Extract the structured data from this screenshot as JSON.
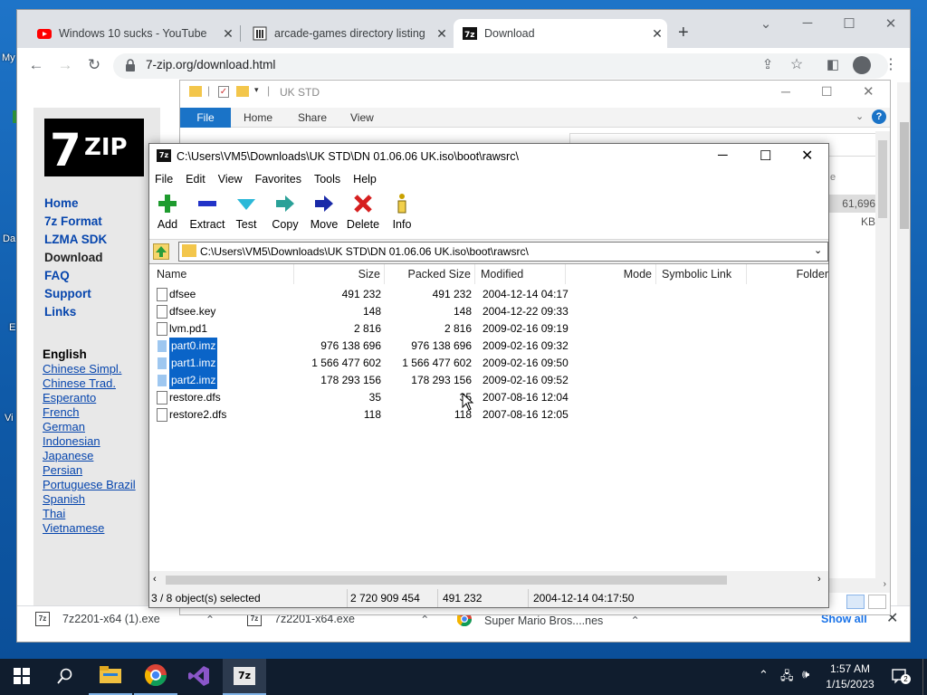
{
  "desktop": {
    "labels": [
      "My",
      "Da",
      "E",
      "Vi"
    ]
  },
  "browser": {
    "tabs": [
      {
        "title": "Windows 10 sucks - YouTube",
        "favicon": "youtube-icon"
      },
      {
        "title": "arcade-games directory listing",
        "favicon": "archive-icon"
      },
      {
        "title": "Download",
        "favicon": "7zip-icon",
        "active": true
      }
    ],
    "url": "7-zip.org/download.html"
  },
  "site": {
    "logo": "7ZIP",
    "nav": [
      "Home",
      "7z Format",
      "LZMA SDK",
      "Download",
      "FAQ",
      "Support",
      "Links"
    ],
    "current": "Download",
    "lang_heading": "English",
    "languages": [
      "Chinese Simpl.",
      "Chinese Trad.",
      "Esperanto",
      "French",
      "German",
      "Indonesian",
      "Japanese",
      "Persian",
      "Portuguese Brazil",
      "Spanish",
      "Thai",
      "Vietnamese"
    ]
  },
  "explorer": {
    "title": "UK STD",
    "ribbon": [
      "File",
      "Home",
      "Share",
      "View"
    ],
    "size_cell": "61,696 KB",
    "col_hint": "e"
  },
  "sevenzip": {
    "title": "C:\\Users\\VM5\\Downloads\\UK STD\\DN 01.06.06 UK.iso\\boot\\rawsrc\\",
    "menu": [
      "File",
      "Edit",
      "View",
      "Favorites",
      "Tools",
      "Help"
    ],
    "toolbar": [
      "Add",
      "Extract",
      "Test",
      "Copy",
      "Move",
      "Delete",
      "Info"
    ],
    "address": "C:\\Users\\VM5\\Downloads\\UK STD\\DN 01.06.06 UK.iso\\boot\\rawsrc\\",
    "columns": [
      "Name",
      "Size",
      "Packed Size",
      "Modified",
      "Mode",
      "Symbolic Link",
      "Folder"
    ],
    "files": [
      {
        "name": "dfsee",
        "size": "491 232",
        "packed": "491 232",
        "modified": "2004-12-14 04:17",
        "selected": false
      },
      {
        "name": "dfsee.key",
        "size": "148",
        "packed": "148",
        "modified": "2004-12-22 09:33",
        "selected": false
      },
      {
        "name": "lvm.pd1",
        "size": "2 816",
        "packed": "2 816",
        "modified": "2009-02-16 09:19",
        "selected": false
      },
      {
        "name": "part0.imz",
        "size": "976 138 696",
        "packed": "976 138 696",
        "modified": "2009-02-16 09:32",
        "selected": true
      },
      {
        "name": "part1.imz",
        "size": "1 566 477 602",
        "packed": "1 566 477 602",
        "modified": "2009-02-16 09:50",
        "selected": true
      },
      {
        "name": "part2.imz",
        "size": "178 293 156",
        "packed": "178 293 156",
        "modified": "2009-02-16 09:52",
        "selected": true
      },
      {
        "name": "restore.dfs",
        "size": "35",
        "packed": "35",
        "modified": "2007-08-16 12:04",
        "selected": false
      },
      {
        "name": "restore2.dfs",
        "size": "118",
        "packed": "118",
        "modified": "2007-08-16 12:05",
        "selected": false
      }
    ],
    "status": {
      "selection": "3 / 8 object(s) selected",
      "total_size": "2 720 909 454",
      "packed": "491 232",
      "modified": "2004-12-14 04:17:50"
    }
  },
  "downloads": [
    {
      "name": "7z2201-x64 (1).exe"
    },
    {
      "name": "7z2201-x64.exe"
    },
    {
      "name": "Super Mario Bros....nes"
    }
  ],
  "downloads_show_all": "Show all",
  "taskbar": {
    "time": "1:57 AM",
    "date": "1/15/2023",
    "notif_count": "2"
  }
}
